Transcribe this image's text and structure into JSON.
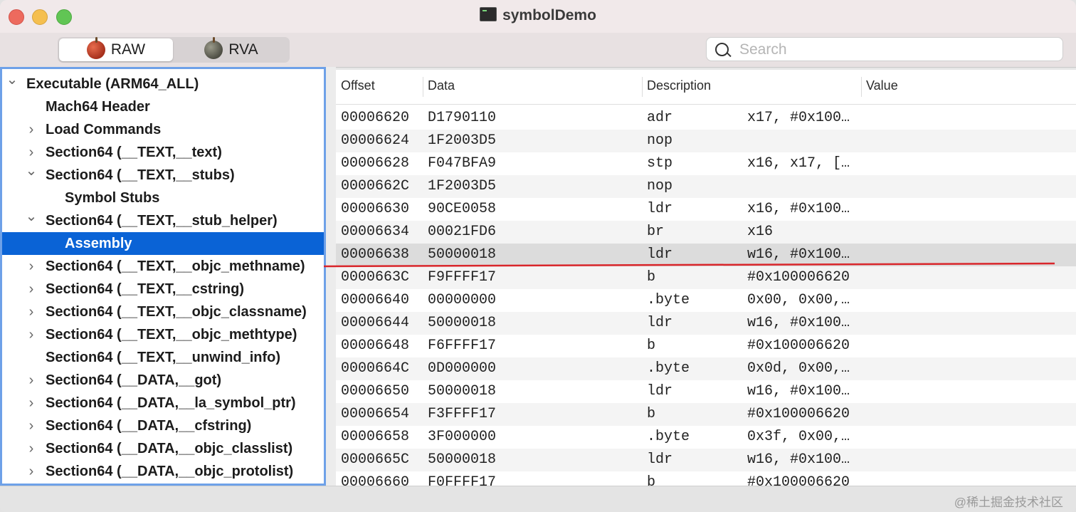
{
  "window": {
    "title": "symbolDemo"
  },
  "toolbar": {
    "segments": [
      {
        "label": "RAW"
      },
      {
        "label": "RVA"
      }
    ],
    "search": {
      "placeholder": "Search",
      "value": ""
    }
  },
  "sidebar": {
    "items": [
      {
        "label": "Executable  (ARM64_ALL)",
        "chevron": "⌄"
      },
      {
        "label": "Mach64 Header",
        "chevron": ""
      },
      {
        "label": "Load Commands",
        "chevron": "›"
      },
      {
        "label": "Section64 (__TEXT,__text)",
        "chevron": "›"
      },
      {
        "label": "Section64 (__TEXT,__stubs)",
        "chevron": "⌄"
      },
      {
        "label": "Symbol Stubs",
        "chevron": ""
      },
      {
        "label": "Section64 (__TEXT,__stub_helper)",
        "chevron": "⌄"
      },
      {
        "label": "Assembly",
        "chevron": ""
      },
      {
        "label": "Section64 (__TEXT,__objc_methname)",
        "chevron": "›"
      },
      {
        "label": "Section64 (__TEXT,__cstring)",
        "chevron": "›"
      },
      {
        "label": "Section64 (__TEXT,__objc_classname)",
        "chevron": "›"
      },
      {
        "label": "Section64 (__TEXT,__objc_methtype)",
        "chevron": "›"
      },
      {
        "label": "Section64 (__TEXT,__unwind_info)",
        "chevron": ""
      },
      {
        "label": "Section64 (__DATA,__got)",
        "chevron": "›"
      },
      {
        "label": "Section64 (__DATA,__la_symbol_ptr)",
        "chevron": "›"
      },
      {
        "label": "Section64 (__DATA,__cfstring)",
        "chevron": "›"
      },
      {
        "label": "Section64 (__DATA,__objc_classlist)",
        "chevron": "›"
      },
      {
        "label": "Section64 (__DATA,__objc_protolist)",
        "chevron": "›"
      }
    ]
  },
  "table": {
    "columns": [
      "Offset",
      "Data",
      "Description",
      "Value"
    ],
    "rows": [
      {
        "offset": "00006620",
        "data": "D1790110",
        "mnemonic": "adr",
        "operands": "x17, #0x100…"
      },
      {
        "offset": "00006624",
        "data": "1F2003D5",
        "mnemonic": "nop",
        "operands": ""
      },
      {
        "offset": "00006628",
        "data": "F047BFA9",
        "mnemonic": "stp",
        "operands": "x16, x17, […"
      },
      {
        "offset": "0000662C",
        "data": "1F2003D5",
        "mnemonic": "nop",
        "operands": ""
      },
      {
        "offset": "00006630",
        "data": "90CE0058",
        "mnemonic": "ldr",
        "operands": "x16, #0x100…"
      },
      {
        "offset": "00006634",
        "data": "00021FD6",
        "mnemonic": "br",
        "operands": "x16"
      },
      {
        "offset": "00006638",
        "data": "50000018",
        "mnemonic": "ldr",
        "operands": "w16, #0x100…"
      },
      {
        "offset": "0000663C",
        "data": "F9FFFF17",
        "mnemonic": "b",
        "operands": "#0x100006620"
      },
      {
        "offset": "00006640",
        "data": "00000000",
        "mnemonic": ".byte",
        "operands": "0x00, 0x00,…"
      },
      {
        "offset": "00006644",
        "data": "50000018",
        "mnemonic": "ldr",
        "operands": "w16, #0x100…"
      },
      {
        "offset": "00006648",
        "data": "F6FFFF17",
        "mnemonic": "b",
        "operands": "#0x100006620"
      },
      {
        "offset": "0000664C",
        "data": "0D000000",
        "mnemonic": ".byte",
        "operands": "0x0d, 0x00,…"
      },
      {
        "offset": "00006650",
        "data": "50000018",
        "mnemonic": "ldr",
        "operands": "w16, #0x100…"
      },
      {
        "offset": "00006654",
        "data": "F3FFFF17",
        "mnemonic": "b",
        "operands": "#0x100006620"
      },
      {
        "offset": "00006658",
        "data": "3F000000",
        "mnemonic": ".byte",
        "operands": "0x3f, 0x00,…"
      },
      {
        "offset": "0000665C",
        "data": "50000018",
        "mnemonic": "ldr",
        "operands": "w16, #0x100…"
      },
      {
        "offset": "00006660",
        "data": "F0FFFF17",
        "mnemonic": "b",
        "operands": "#0x100006620"
      }
    ]
  },
  "watermark": "@稀土掘金技术社区",
  "colors": {
    "selection": "#0a63d6",
    "sidebar_border": "#6ea1e8",
    "annotation_line": "#d9262b"
  }
}
